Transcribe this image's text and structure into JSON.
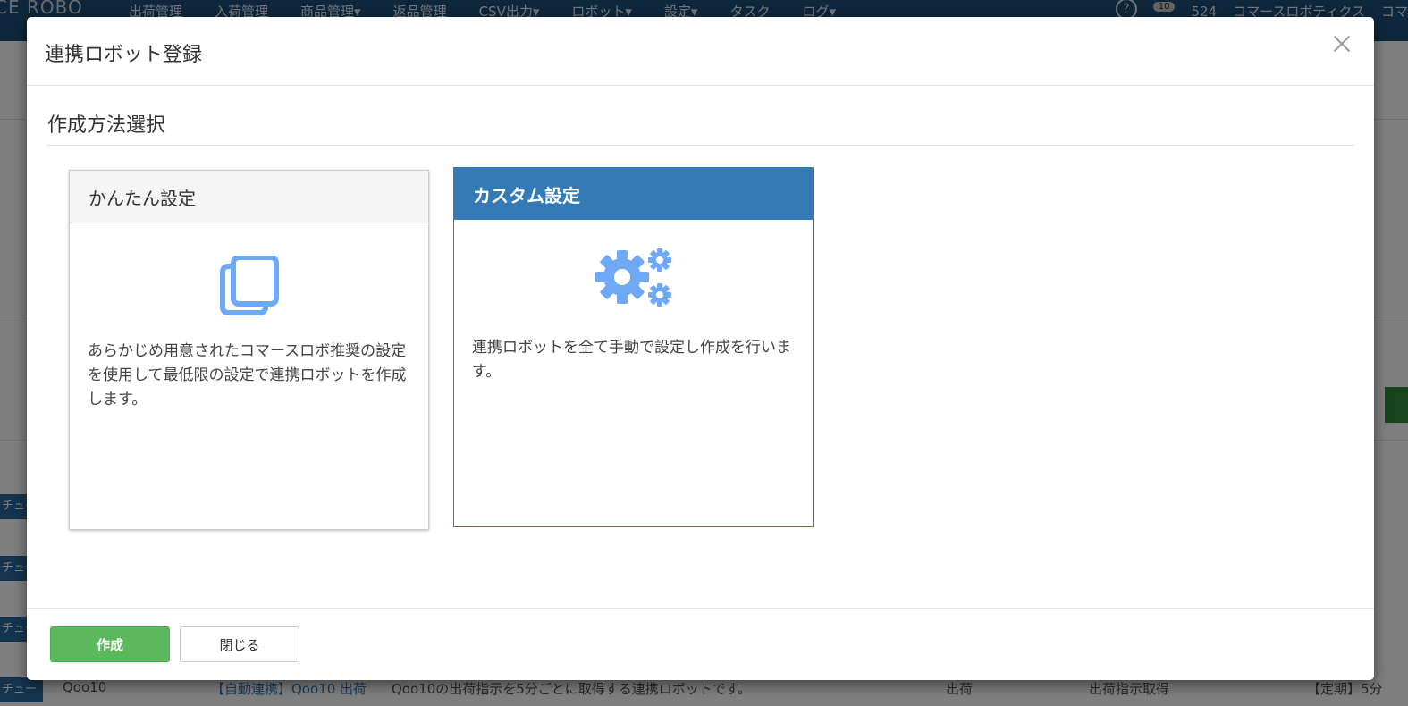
{
  "background": {
    "logo": "CE ROBO",
    "nav": [
      "出荷管理",
      "入荷管理",
      "商品管理▾",
      "返品管理",
      "CSV出力▾",
      "ロボット▾",
      "設定▾",
      "タスク",
      "ログ▾"
    ],
    "notification_count": "10",
    "user_id": "524",
    "company": "コマースロボティクス",
    "company_short": "コマ",
    "row_shop": "Qoo10",
    "row_robot": "【自動連携】Qoo10 出荷",
    "row_desc": "Qoo10の出荷指示を5分ごとに取得する連携ロボットです。",
    "row_type": "出荷",
    "row_action": "出荷指示取得",
    "row_schedule": "【定期】5分",
    "tag_label": "チュー"
  },
  "modal": {
    "title": "連携ロボット登録",
    "section_title": "作成方法選択",
    "cards": [
      {
        "title": "かんたん設定",
        "icon": "copy-icon",
        "description": "あらかじめ用意されたコマースロボ推奨の設定を使用して最低限の設定で連携ロボットを作成します。"
      },
      {
        "title": "カスタム設定",
        "icon": "gears-icon",
        "description": "連携ロボットを全て手動で設定し作成を行います。",
        "selected": true
      }
    ],
    "buttons": {
      "create": "作成",
      "close": "閉じる"
    }
  },
  "colors": {
    "primary": "#337ab7",
    "success": "#5cb85c",
    "icon": "#6fa8f5",
    "nav": "#1f4e79"
  }
}
